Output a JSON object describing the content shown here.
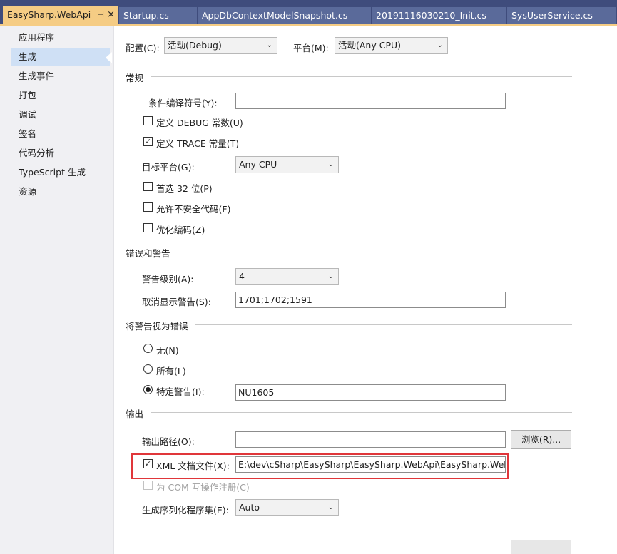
{
  "tabs": [
    {
      "label": "EasySharp.WebApi",
      "pin": "⊣",
      "close": "×"
    },
    {
      "label": "Startup.cs"
    },
    {
      "label": "AppDbContextModelSnapshot.cs"
    },
    {
      "label": "20191116030210_Init.cs"
    },
    {
      "label": "SysUserService.cs"
    }
  ],
  "nav": [
    "应用程序",
    "生成",
    "生成事件",
    "打包",
    "调试",
    "签名",
    "代码分析",
    "TypeScript 生成",
    "资源"
  ],
  "top": {
    "config_label": "配置(C):",
    "config_value": "活动(Debug)",
    "platform_label": "平台(M):",
    "platform_value": "活动(Any CPU)"
  },
  "general": {
    "title": "常规",
    "symbols_label": "条件编译符号(Y):",
    "symbols_value": "",
    "debug_label": "定义 DEBUG 常数(U)",
    "debug_checked": false,
    "trace_label": "定义 TRACE 常量(T)",
    "trace_checked": true,
    "platform_target_label": "目标平台(G):",
    "platform_target_value": "Any CPU",
    "prefer32_label": "首选 32 位(P)",
    "unsafe_label": "允许不安全代码(F)",
    "optimize_label": "优化编码(Z)"
  },
  "errors": {
    "title": "错误和警告",
    "warning_level_label": "警告级别(A):",
    "warning_level_value": "4",
    "suppress_label": "取消显示警告(S):",
    "suppress_value": "1701;1702;1591"
  },
  "treat_as_errors": {
    "title": "将警告视为错误",
    "none_label": "无(N)",
    "all_label": "所有(L)",
    "specific_label": "特定警告(I):",
    "specific_value": "NU1605",
    "selected": "specific"
  },
  "output": {
    "title": "输出",
    "path_label": "输出路径(O):",
    "path_value": "",
    "browse_label": "浏览(R)...",
    "xml_label": "XML 文档文件(X):",
    "xml_checked": true,
    "xml_value": "E:\\dev\\cSharp\\EasySharp\\EasySharp.WebApi\\EasySharp.WebApi",
    "com_label": "为 COM 互操作注册(C)",
    "serialization_label": "生成序列化程序集(E):",
    "serialization_value": "Auto"
  },
  "colors": {
    "accent_tab": "#f5cc84",
    "highlight": "#e0363a",
    "nav_selected": "#cfe0f5"
  }
}
